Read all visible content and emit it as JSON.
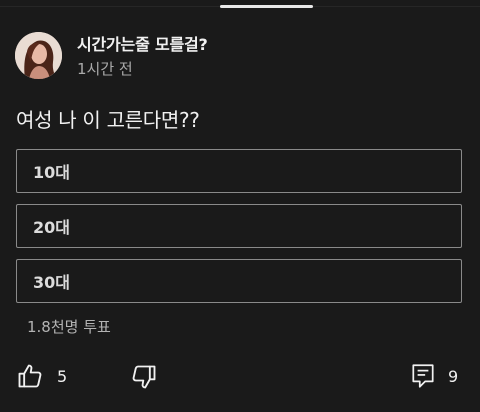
{
  "post": {
    "author": "시간가는줄 모를걸?",
    "time": "1시간 전",
    "question": "여성 나 이 고른다면??"
  },
  "poll": {
    "options": [
      "10대",
      "20대",
      "30대"
    ],
    "votes": "1.8천명 투표"
  },
  "actions": {
    "likes": "5",
    "comments": "9"
  },
  "icons": [
    "thumb-up-icon",
    "thumb-down-icon",
    "comment-icon"
  ]
}
